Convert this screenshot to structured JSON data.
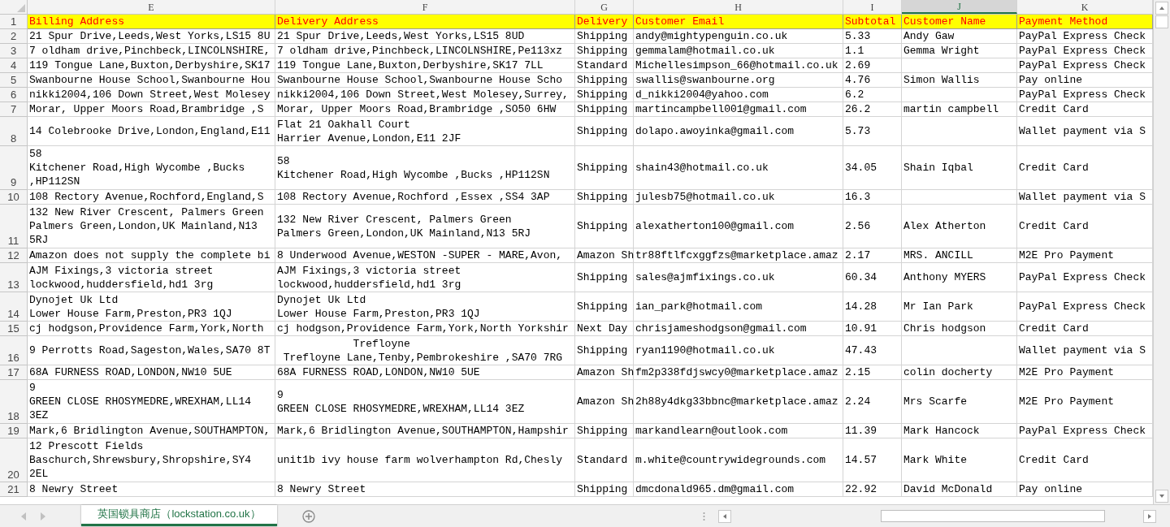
{
  "table": {
    "columns": [
      {
        "letter": "E",
        "selected": false
      },
      {
        "letter": "F",
        "selected": false
      },
      {
        "letter": "G",
        "selected": false
      },
      {
        "letter": "H",
        "selected": false
      },
      {
        "letter": "I",
        "selected": false
      },
      {
        "letter": "J",
        "selected": true
      },
      {
        "letter": "K",
        "selected": false
      }
    ],
    "header_row": {
      "number": "1",
      "cells": [
        "Billing Address",
        "Delivery Address",
        "Delivery",
        "Customer Email",
        "Subtotal",
        "Customer Name",
        "Payment Method"
      ]
    },
    "rows": [
      {
        "number": "2",
        "cells": [
          "21 Spur Drive,Leeds,West Yorks,LS15 8U",
          "21 Spur Drive,Leeds,West Yorks,LS15 8UD",
          "Shipping",
          "andy@mightypenguin.co.uk",
          "5.33",
          "Andy Gaw",
          "PayPal Express Check"
        ]
      },
      {
        "number": "3",
        "cells": [
          "7 oldham drive,Pinchbeck,LINCOLNSHIRE,",
          "7 oldham drive,Pinchbeck,LINCOLNSHIRE,Pe113xz",
          "Shipping",
          "gemmalam@hotmail.co.uk",
          "1.1",
          "Gemma Wright",
          "PayPal Express Check"
        ]
      },
      {
        "number": "4",
        "cells": [
          "119 Tongue Lane,Buxton,Derbyshire,SK17",
          "119 Tongue Lane,Buxton,Derbyshire,SK17 7LL",
          "Standard",
          "Michellesimpson_66@hotmail.co.uk",
          "2.69",
          null,
          "PayPal Express Check"
        ]
      },
      {
        "number": "5",
        "cells": [
          "Swanbourne House School,Swanbourne Hou",
          "Swanbourne House School,Swanbourne House Scho",
          "Shipping",
          "swallis@swanbourne.org",
          "4.76",
          "Simon Wallis",
          "Pay online"
        ]
      },
      {
        "number": "6",
        "cells": [
          "nikki2004,106 Down Street,West Molesey",
          "nikki2004,106 Down Street,West Molesey,Surrey,",
          "Shipping",
          "d_nikki2004@yahoo.com",
          "6.2",
          null,
          "PayPal Express Check"
        ]
      },
      {
        "number": "7",
        "cells": [
          "Morar, Upper Moors Road,Brambridge ,S",
          "Morar, Upper Moors Road,Brambridge ,SO50 6HW",
          "Shipping",
          "martincampbell001@gmail.com",
          "26.2",
          "martin campbell",
          "Credit Card"
        ]
      },
      {
        "number": "8",
        "cells": [
          "14 Colebrooke Drive,London,England,E11",
          "Flat 21 Oakhall Court\nHarrier Avenue,London,E11 2JF",
          "Shipping",
          "dolapo.awoyinka@gmail.com",
          "5.73",
          null,
          "Wallet payment via S"
        ]
      },
      {
        "number": "9",
        "cells": [
          "58\nKitchener Road,High Wycombe ,Bucks\n,HP112SN",
          "58\nKitchener Road,High Wycombe ,Bucks ,HP112SN",
          "Shipping",
          "shain43@hotmail.co.uk",
          "34.05",
          "Shain Iqbal",
          "Credit Card"
        ]
      },
      {
        "number": "10",
        "cells": [
          "108 Rectory Avenue,Rochford,England,S",
          "108 Rectory Avenue,Rochford ,Essex ,SS4 3AP",
          "Shipping",
          "julesb75@hotmail.co.uk",
          "16.3",
          null,
          "Wallet payment via S"
        ]
      },
      {
        "number": "11",
        "cells": [
          "132 New River Crescent, Palmers Green\nPalmers Green,London,UK Mainland,N13\n5RJ",
          "132 New River Crescent, Palmers Green\nPalmers Green,London,UK Mainland,N13 5RJ",
          "Shipping",
          "alexatherton100@gmail.com",
          "2.56",
          "Alex Atherton",
          "Credit Card"
        ]
      },
      {
        "number": "12",
        "cells": [
          "Amazon does not supply the complete bi",
          "8 Underwood Avenue,WESTON -SUPER - MARE,Avon,",
          "Amazon Sh",
          "tr88ftlfcxggfzs@marketplace.amaz",
          "2.17",
          "MRS. ANCILL",
          "M2E Pro Payment"
        ]
      },
      {
        "number": "13",
        "cells": [
          "AJM Fixings,3 victoria street\nlockwood,huddersfield,hd1 3rg",
          "AJM Fixings,3 victoria street\nlockwood,huddersfield,hd1 3rg",
          "Shipping",
          "sales@ajmfixings.co.uk",
          "60.34",
          "Anthony MYERS",
          "PayPal Express Check"
        ]
      },
      {
        "number": "14",
        "cells": [
          "Dynojet Uk Ltd\nLower House Farm,Preston,PR3 1QJ",
          "Dynojet Uk Ltd\nLower House Farm,Preston,PR3 1QJ",
          "Shipping",
          "ian_park@hotmail.com",
          "14.28",
          "Mr Ian Park",
          "PayPal Express Check"
        ]
      },
      {
        "number": "15",
        "cells": [
          "cj hodgson,Providence Farm,York,North",
          "cj hodgson,Providence Farm,York,North Yorkshir",
          "Next Day",
          "chrisjameshodgson@gmail.com",
          "10.91",
          "Chris hodgson",
          "Credit Card"
        ]
      },
      {
        "number": "16",
        "cells": [
          "9 Perrotts Road,Sageston,Wales,SA70 8T",
          "            Trefloyne\n Trefloyne Lane,Tenby,Pembrokeshire ,SA70 7RG",
          "Shipping",
          "ryan1190@hotmail.co.uk",
          "47.43",
          null,
          "Wallet payment via S"
        ]
      },
      {
        "number": "17",
        "cells": [
          "68A FURNESS ROAD,LONDON,NW10 5UE",
          "68A FURNESS ROAD,LONDON,NW10 5UE",
          "Amazon Sh",
          "fm2p338fdjswcy0@marketplace.amaz",
          "2.15",
          "colin docherty",
          "M2E Pro Payment"
        ]
      },
      {
        "number": "18",
        "cells": [
          "9\nGREEN CLOSE RHOSYMEDRE,WREXHAM,LL14\n3EZ",
          "9\nGREEN CLOSE RHOSYMEDRE,WREXHAM,LL14 3EZ",
          "Amazon Sh",
          "2h88y4dkg33bbnc@marketplace.amaz",
          "2.24",
          "Mrs Scarfe",
          "M2E Pro Payment"
        ]
      },
      {
        "number": "19",
        "cells": [
          "Mark,6 Bridlington Avenue,SOUTHAMPTON,",
          "Mark,6 Bridlington Avenue,SOUTHAMPTON,Hampshir",
          "Shipping",
          "markandlearn@outlook.com",
          "11.39",
          "Mark Hancock",
          "PayPal Express Check"
        ]
      },
      {
        "number": "20",
        "cells": [
          "12 Prescott Fields\nBaschurch,Shrewsbury,Shropshire,SY4\n2EL",
          "unit1b ivy house farm wolverhampton Rd,Chesly",
          "Standard",
          "m.white@countrywidegrounds.com",
          "14.57",
          "Mark White",
          "Credit Card"
        ]
      },
      {
        "number": "21",
        "cells": [
          "8 Newry Street",
          "8 Newry Street",
          "Shipping",
          "dmcdonald965.dm@gmail.com",
          "22.92",
          "David McDonald",
          "Pay online"
        ]
      }
    ]
  },
  "sheet_tabs": [
    {
      "label": "英国锁具商店（lockstation.co.uk）",
      "selected": true
    }
  ]
}
